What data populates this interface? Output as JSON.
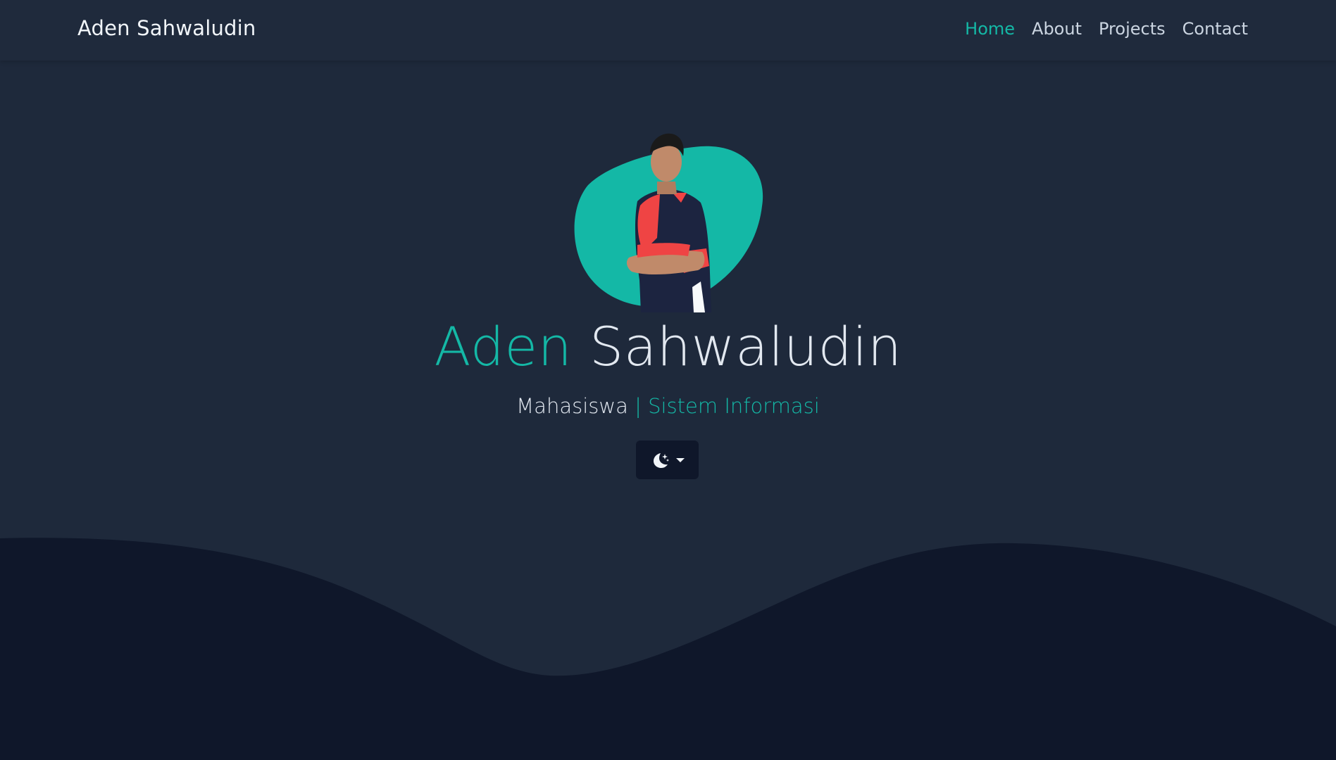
{
  "nav": {
    "brand": "Aden Sahwaludin",
    "links": [
      {
        "label": "Home",
        "active": true
      },
      {
        "label": "About",
        "active": false
      },
      {
        "label": "Projects",
        "active": false
      },
      {
        "label": "Contact",
        "active": false
      }
    ]
  },
  "hero": {
    "first_name": "Aden",
    "last_name": "Sahwaludin",
    "subtitle_role": "Mahasiswa",
    "subtitle_separator": "|",
    "subtitle_major": "Sistem Informasi",
    "theme_toggle": {
      "icon": "moon-stars-icon",
      "dropdown_icon": "caret-down-icon"
    }
  },
  "colors": {
    "accent": "#14b8a6",
    "background": "#1e293b",
    "navbar": "#1f2a3c",
    "wave": "#0f172a",
    "text": "#e2e8f0"
  }
}
